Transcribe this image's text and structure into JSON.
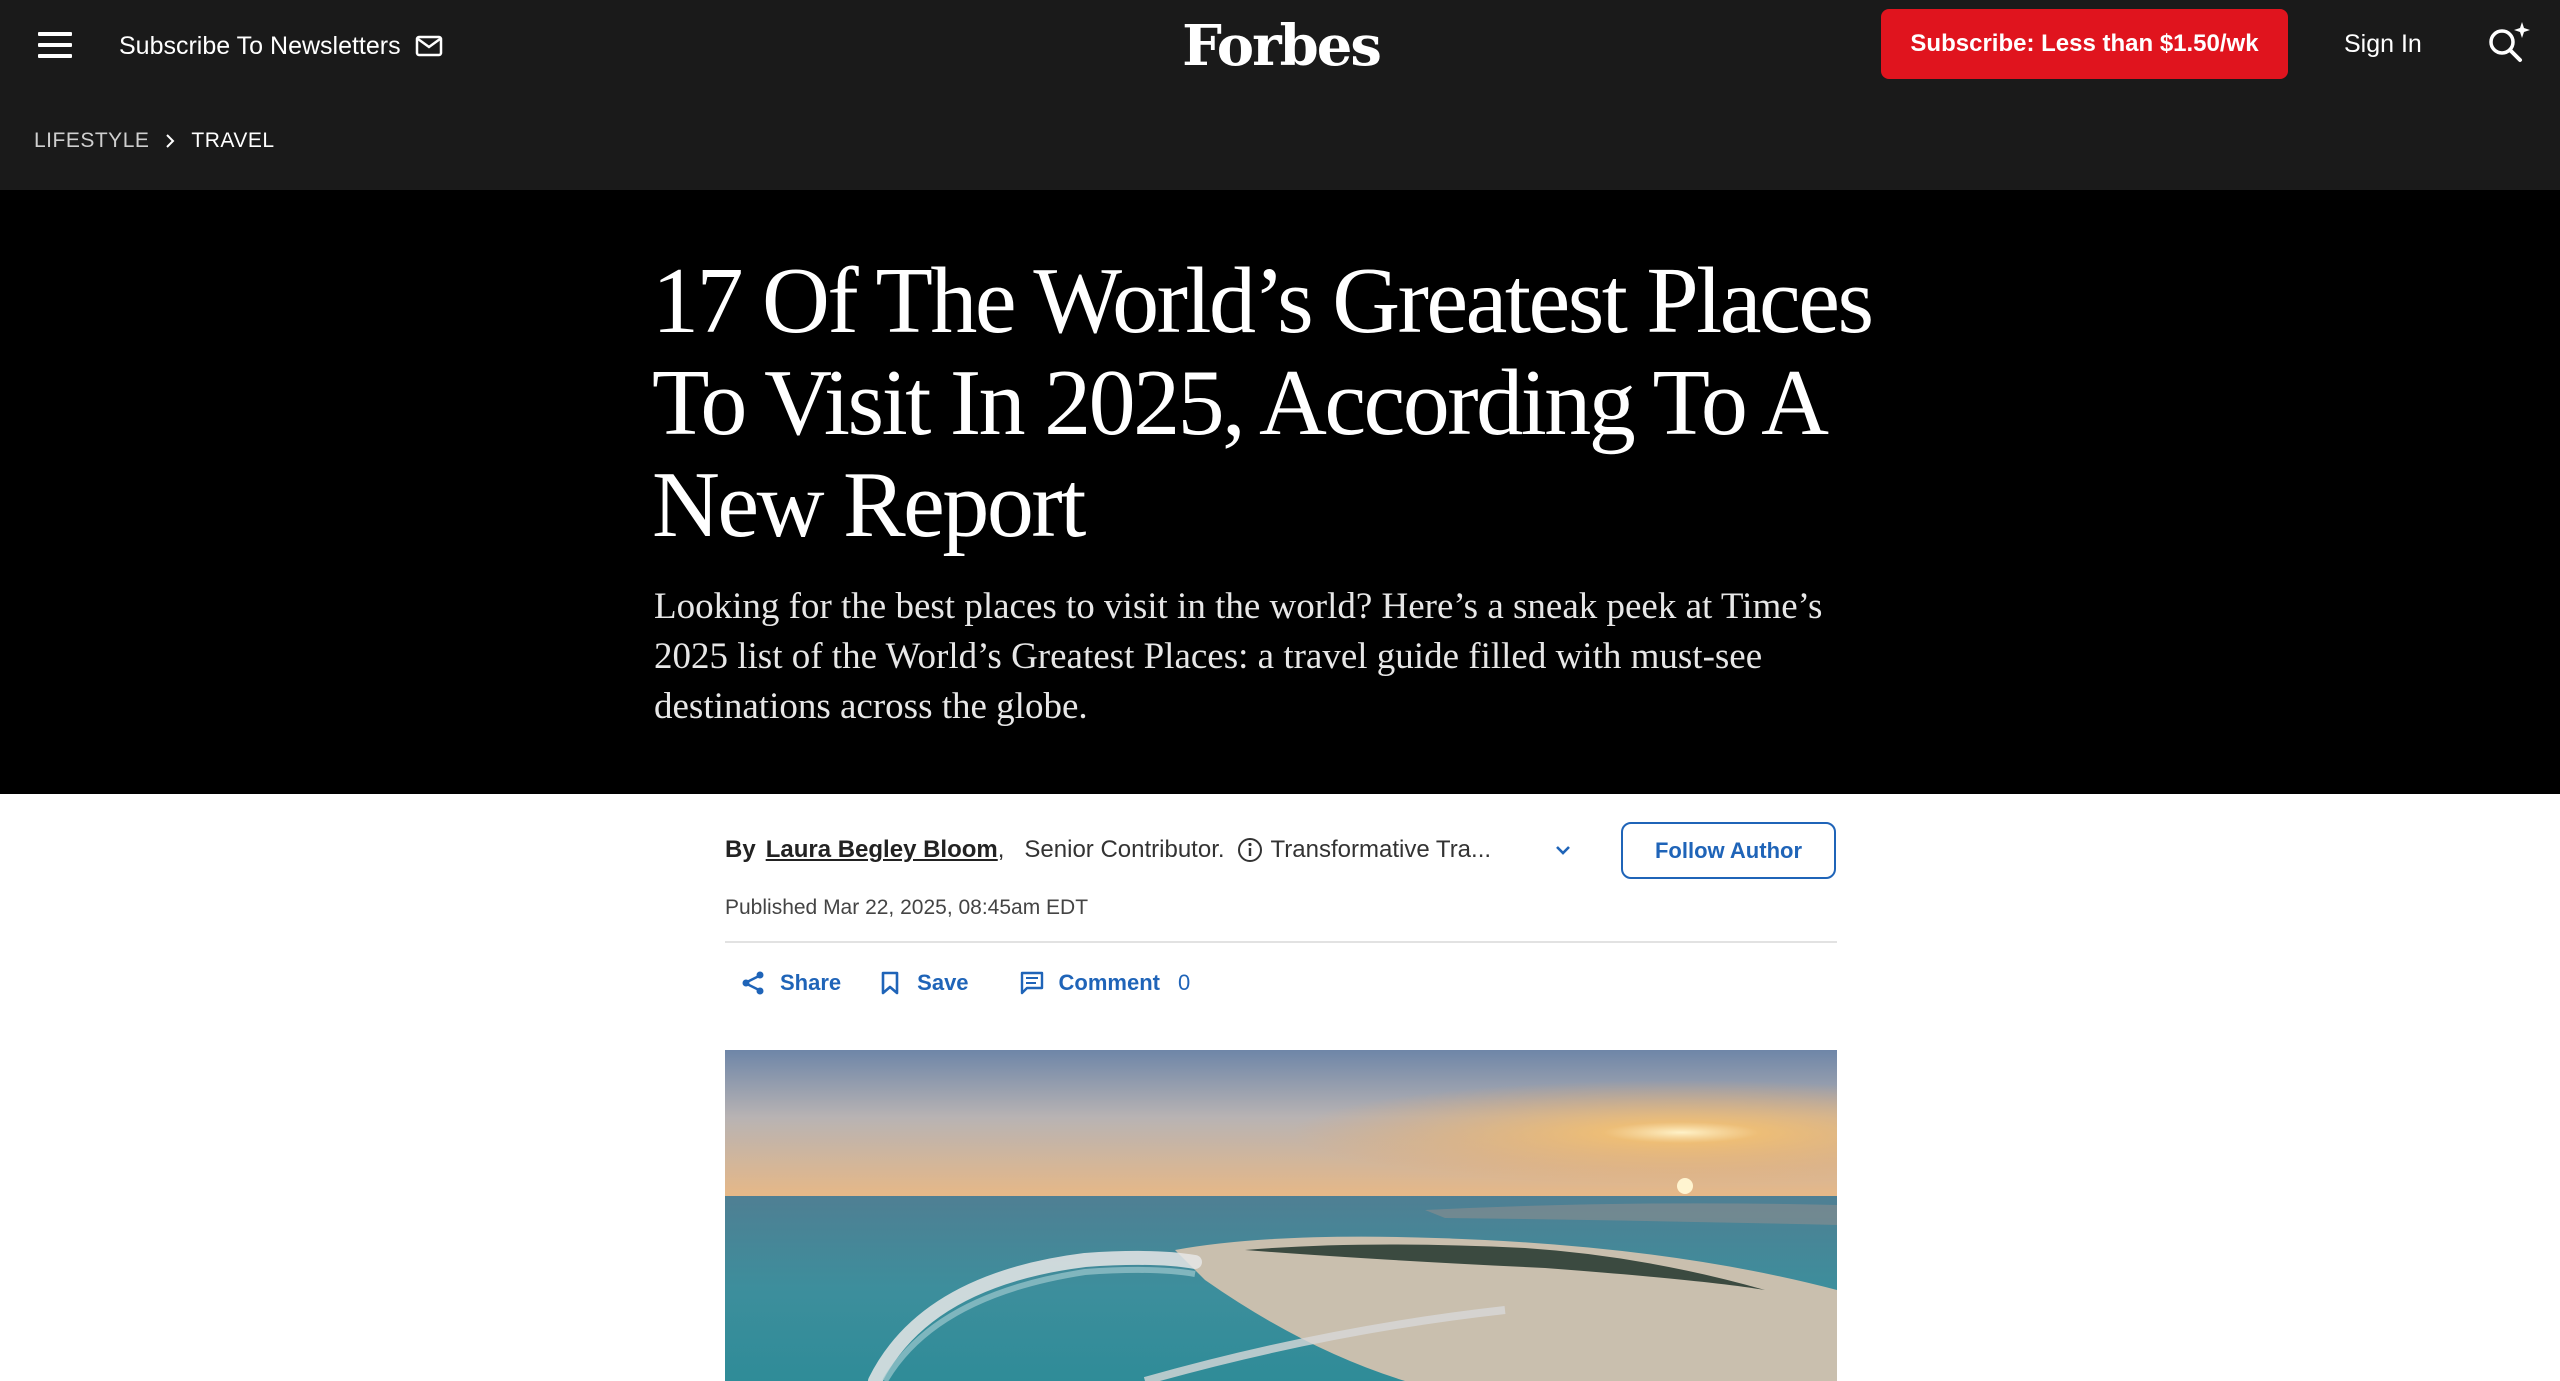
{
  "header": {
    "menu_icon": "hamburger-menu-icon",
    "newsletter_label": "Subscribe To Newsletters",
    "newsletter_icon": "mail-icon",
    "logo_text": "Forbes",
    "subscribe_label": "Subscribe: Less than $1.50/wk",
    "signin_label": "Sign In",
    "search_icon": "search-sparkle-icon",
    "subscribe_color": "#e0141e",
    "background": "#1a1a1a"
  },
  "breadcrumb": {
    "items": [
      "LIFESTYLE",
      "TRAVEL"
    ],
    "separator_icon": "chevron-right-icon"
  },
  "article": {
    "headline": "17 Of The World’s Greatest Places To Visit In 2025, According To A New Report",
    "dek": "Looking for the best places to visit in the world? Here’s a sneak peek at Time’s 2025 list of the World’s Greatest Places: a travel guide filled with must-see destinations across the globe.",
    "byline": {
      "by": "By",
      "author": "Laura Begley Bloom",
      "comma": ",",
      "role": "Senior Contributor.",
      "section": "Transformative Tra...",
      "info_icon": "info-circle-icon",
      "expand_icon": "chevron-down-icon",
      "follow_label": "Follow Author"
    },
    "published": "Published Mar 22, 2025, 08:45am EDT",
    "actions": {
      "share_label": "Share",
      "save_label": "Save",
      "comment_label": "Comment",
      "comment_count": "0",
      "share_icon": "share-icon",
      "save_icon": "bookmark-icon",
      "comment_icon": "comment-icon"
    },
    "hero_image": "aerial-sunset-island-resort-photo"
  },
  "colors": {
    "accent": "#1f64b8",
    "hero_bg": "#000000"
  }
}
